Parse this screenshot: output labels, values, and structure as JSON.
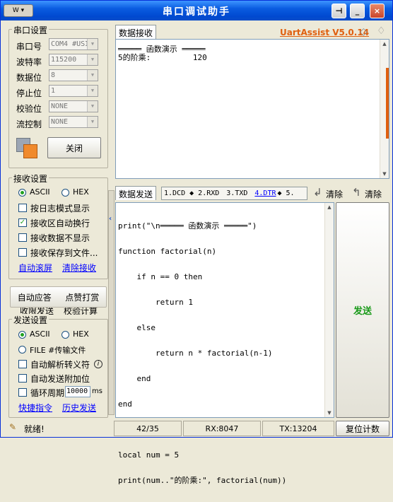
{
  "window": {
    "title": "串口调试助手",
    "sysmenu": "W ▾",
    "pin": "⊣",
    "minimize": "_",
    "close": "×"
  },
  "serial": {
    "group_title": "串口设置",
    "port_label": "串口号",
    "port_value": "COM4 #USI",
    "baud_label": "波特率",
    "baud_value": "115200",
    "data_label": "数据位",
    "data_value": "8",
    "stop_label": "停止位",
    "stop_value": "1",
    "parity_label": "校验位",
    "parity_value": "NONE",
    "flow_label": "流控制",
    "flow_value": "NONE",
    "close_button": "关闭"
  },
  "receive_settings": {
    "group_title": "接收设置",
    "ascii": "ASCII",
    "hex": "HEX",
    "log_mode": "按日志模式显示",
    "auto_wrap": "接收区自动换行",
    "hide_data": "接收数据不显示",
    "save_file": "接收保存到文件...",
    "auto_scroll": "自动滚屏",
    "clear": "清除接收"
  },
  "middle": {
    "auto_reply": "自动应答",
    "click_play": "点赞打赏",
    "partial_left": "收限发送",
    "partial_right": "校验计算"
  },
  "send_settings": {
    "group_title": "发送设置",
    "ascii": "ASCII",
    "hex": "HEX",
    "file": "FILE #传输文件",
    "auto_escape": "自动解析转义符",
    "auto_append": "自动发送附加位",
    "cycle": "循环周期",
    "cycle_value": "10000",
    "cycle_unit": "ms",
    "shortcut": "快捷指令",
    "history": "历史发送"
  },
  "receive": {
    "tab": "数据接收",
    "brand": "UartAssist V5.0.14",
    "lines": [
      "═════ 函数演示 ═════",
      "5的阶乘:         120"
    ]
  },
  "send": {
    "tab": "数据发送",
    "indicators": [
      "1.DCD",
      "2.RXD",
      "3.TXD",
      "4.DTR",
      "5."
    ],
    "clear1": "清除",
    "clear2": "清除",
    "send_button": "发送",
    "lines": [
      "print(\"\\n═════ 函数演示 ═════\")",
      "function factorial(n)",
      "    if n == 0 then",
      "        return 1",
      "    else",
      "        return n * factorial(n-1)",
      "    end",
      "end",
      "",
      "local num = 5",
      "print(num..\"的阶乘:\", factorial(num))"
    ]
  },
  "status": {
    "ready": "就绪!",
    "count": "42/35",
    "rx": "RX:8047",
    "tx": "TX:13204",
    "reset": "复位计数"
  },
  "colors": {
    "title_bar": "#0a5ce0",
    "brand": "#e06010",
    "send_green": "#1a9a1a",
    "link": "#0000ff",
    "scroll_accent": "#e06010"
  }
}
